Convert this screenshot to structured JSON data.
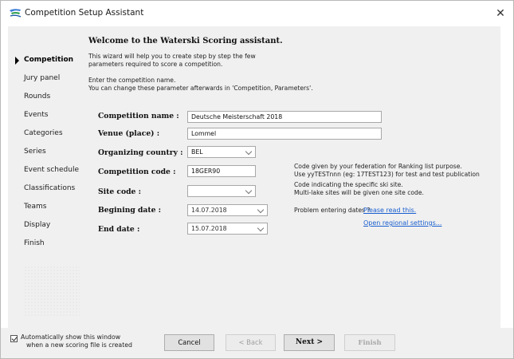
{
  "window": {
    "title": "Competition Setup Assistant"
  },
  "sidebar": {
    "items": [
      {
        "label": "Competition",
        "active": true
      },
      {
        "label": "Jury panel"
      },
      {
        "label": "Rounds"
      },
      {
        "label": "Events"
      },
      {
        "label": "Categories"
      },
      {
        "label": "Series"
      },
      {
        "label": "Event schedule"
      },
      {
        "label": "Classifications"
      },
      {
        "label": "Teams"
      },
      {
        "label": "Display"
      },
      {
        "label": "Finish"
      }
    ]
  },
  "content": {
    "welcome": "Welcome to the Waterski Scoring assistant.",
    "intro_line1": "This wizard will help you to create step by step the few",
    "intro_line2": "parameters required to score a competition.",
    "enter_line1": "Enter the competition name.",
    "enter_line2": "You can change these parameter afterwards in 'Competition, Parameters'.",
    "fields": {
      "competition_name": {
        "label": "Competition name :",
        "value": "Deutsche Meisterschaft 2018"
      },
      "venue": {
        "label": "Venue (place) :",
        "value": "Lommel"
      },
      "country": {
        "label": "Organizing country :",
        "value": "BEL"
      },
      "competition_code": {
        "label": "Competition code :",
        "value": "18GER90"
      },
      "site_code": {
        "label": "Site code :",
        "value": ""
      },
      "begin_date": {
        "label": "Begining date :",
        "value": "14.07.2018"
      },
      "end_date": {
        "label": "End date :",
        "value": "15.07.2018"
      }
    },
    "notes": {
      "code_line1": "Code given by your federation for Ranking list purpose.",
      "code_line2": "Use yyTESTnnn (eg: 17TEST123) for test and test publication",
      "site_line1": "Code indicating the specific ski site.",
      "site_line2": "Multi-lake sites will be given one site code.",
      "dates_problem": "Problem entering dates ?",
      "please_read": "Please read this.",
      "regional": "Open regional settings..."
    }
  },
  "footer": {
    "checkbox_line1": "Automatically show this window",
    "checkbox_line2": "when a new scoring file is created",
    "checkbox_checked": true,
    "cancel": "Cancel",
    "back": "< Back",
    "next": "Next >",
    "finish": "Finish"
  }
}
